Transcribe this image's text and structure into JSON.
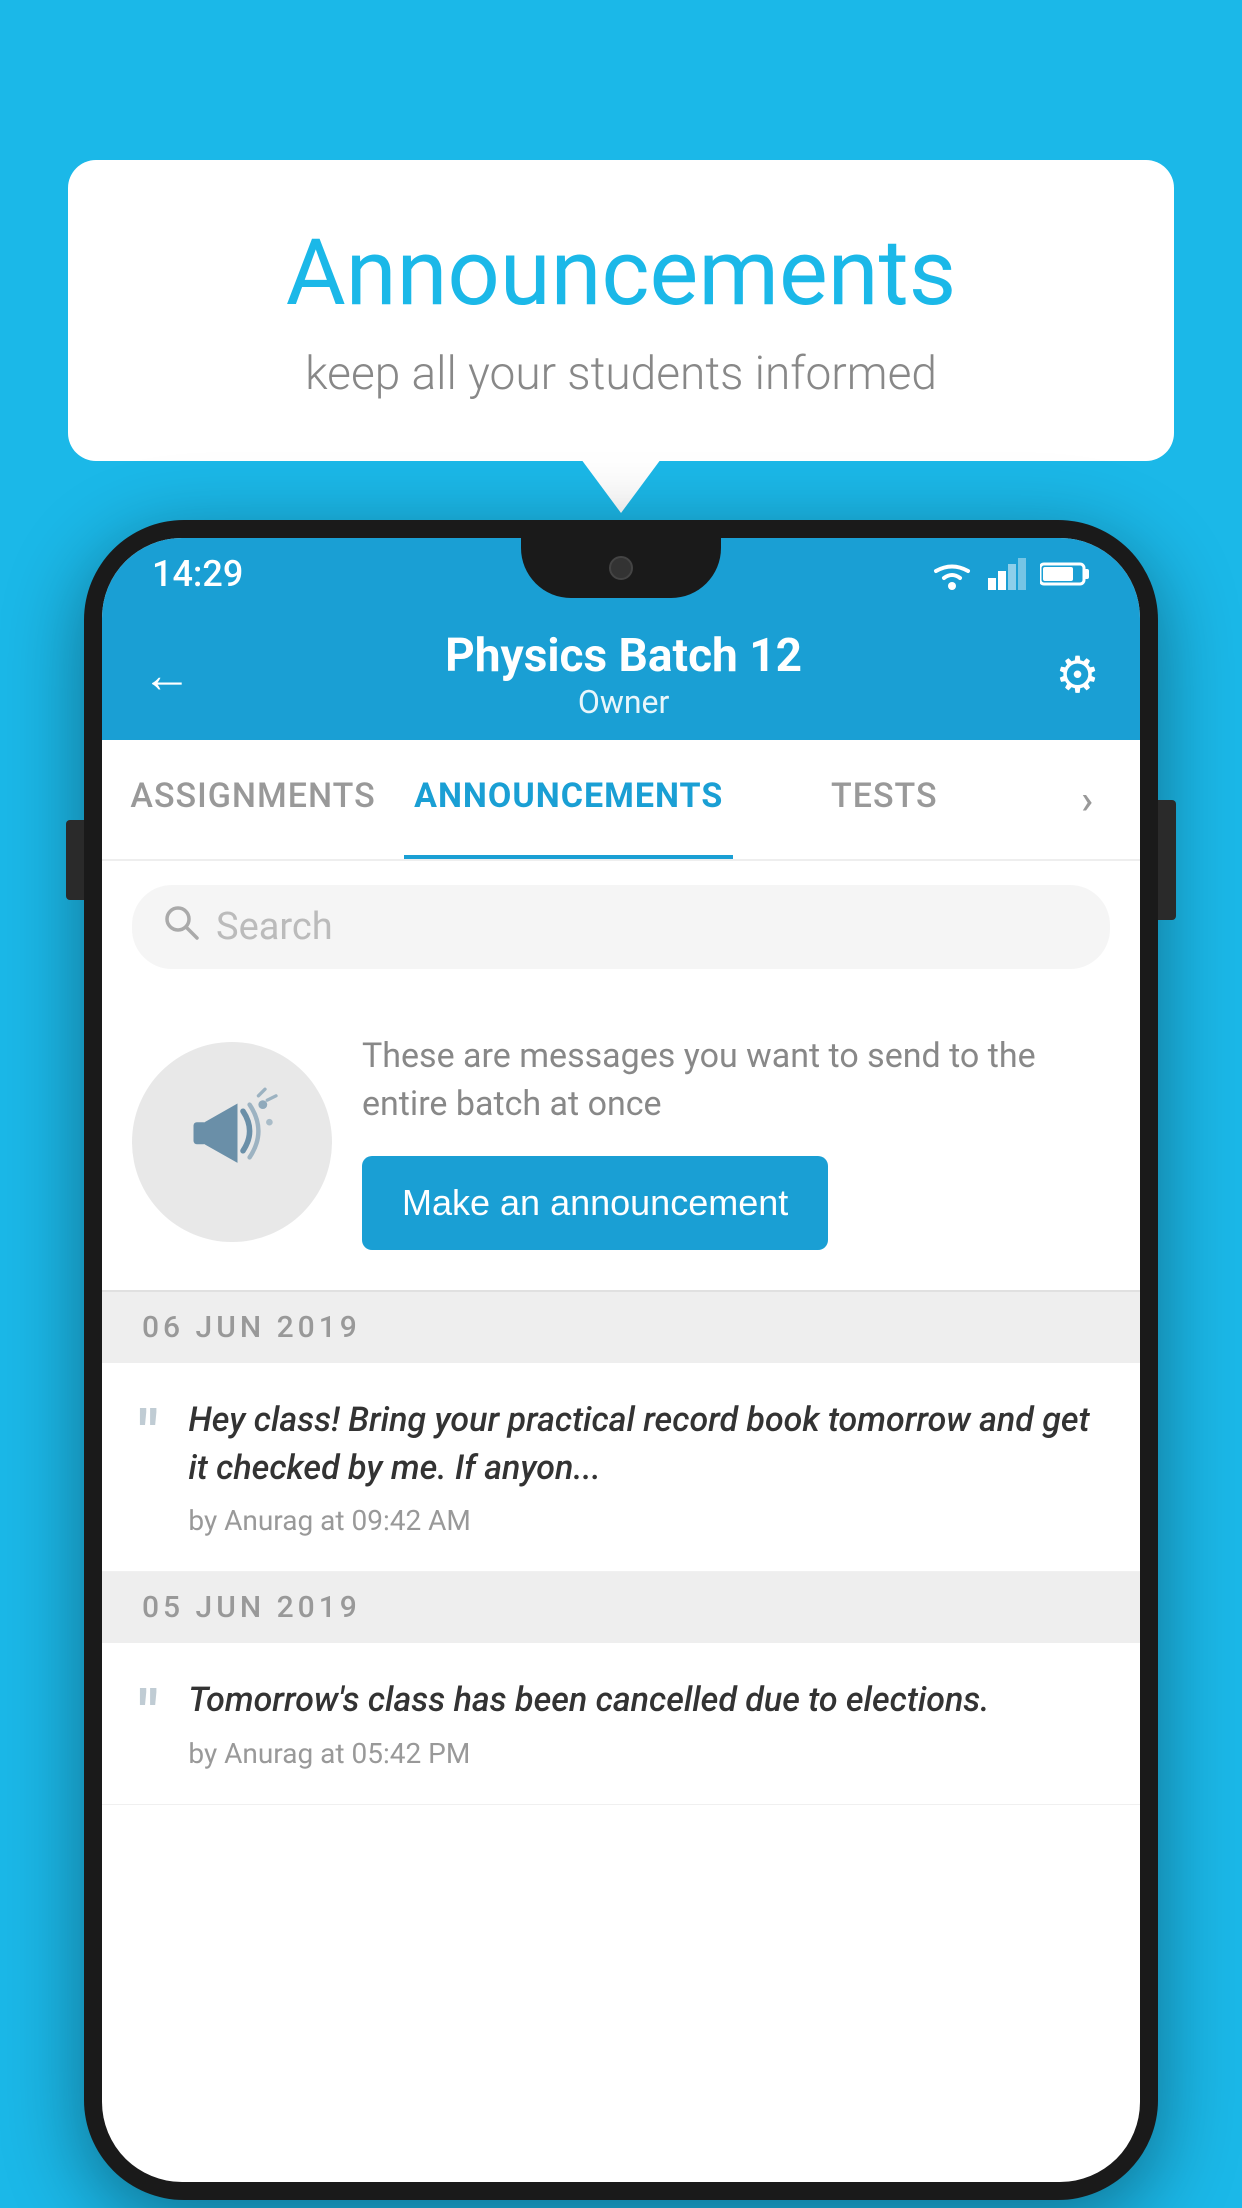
{
  "page": {
    "background_color": "#1BB8E8"
  },
  "speech_bubble": {
    "title": "Announcements",
    "subtitle": "keep all your students informed"
  },
  "status_bar": {
    "time": "14:29"
  },
  "app_header": {
    "title": "Physics Batch 12",
    "subtitle": "Owner",
    "back_label": "←",
    "gear_label": "⚙"
  },
  "tabs": [
    {
      "label": "ASSIGNMENTS",
      "active": false
    },
    {
      "label": "ANNOUNCEMENTS",
      "active": true
    },
    {
      "label": "TESTS",
      "active": false
    },
    {
      "label": "...",
      "active": false
    }
  ],
  "search": {
    "placeholder": "Search"
  },
  "announcement_cta": {
    "description": "These are messages you want to send to the entire batch at once",
    "button_label": "Make an announcement"
  },
  "announcements": [
    {
      "date": "06  JUN  2019",
      "text": "Hey class! Bring your practical record book tomorrow and get it checked by me. If anyon...",
      "meta": "by Anurag at 09:42 AM"
    },
    {
      "date": "05  JUN  2019",
      "text": "Tomorrow's class has been cancelled due to elections.",
      "meta": "by Anurag at 05:42 PM"
    }
  ]
}
